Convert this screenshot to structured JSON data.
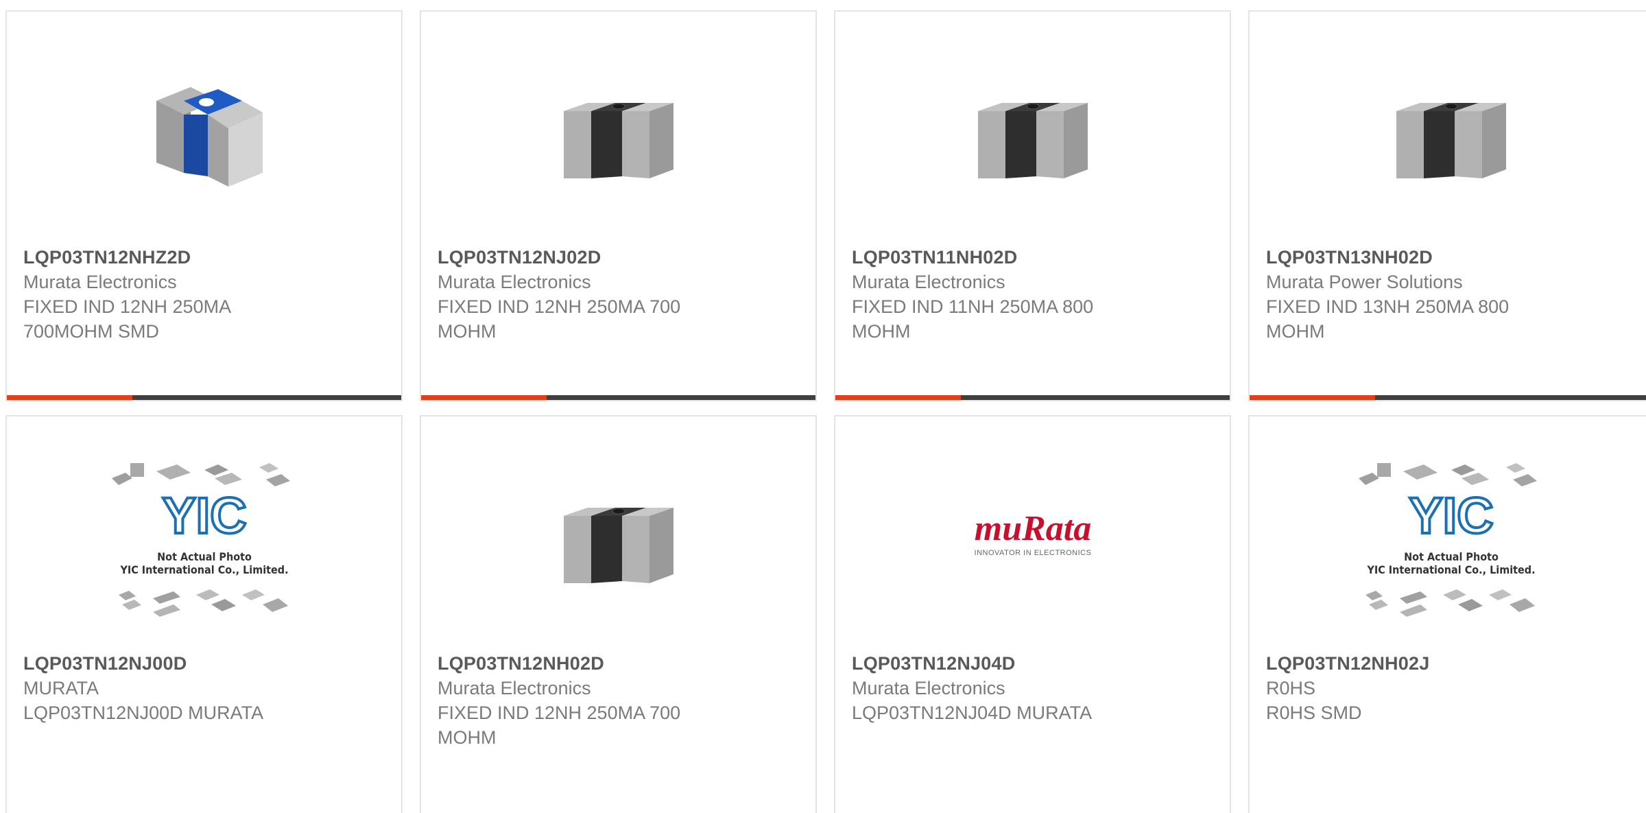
{
  "colors": {
    "accent": "#e0401c",
    "bar": "#3f3f3f",
    "border": "#e4e4e4",
    "part_text": "#595959",
    "sub_text": "#7a7a7a",
    "murata_red": "#c8102e",
    "yic_blue": "#1a6fb5"
  },
  "products": [
    {
      "part": "LQP03TN12NHZ2D",
      "maker": "Murata Electronics",
      "desc": "FIXED IND 12NH 250MA 700MOHM SMD",
      "image": "blue-chip-inductor"
    },
    {
      "part": "LQP03TN12NJ02D",
      "maker": "Murata Electronics",
      "desc": "FIXED IND 12NH 250MA 700 MOHM",
      "image": "black-chip-inductor"
    },
    {
      "part": "LQP03TN11NH02D",
      "maker": "Murata Electronics",
      "desc": "FIXED IND 11NH 250MA 800 MOHM",
      "image": "black-chip-inductor"
    },
    {
      "part": "LQP03TN13NH02D",
      "maker": "Murata Power Solutions",
      "desc": "FIXED IND 13NH 250MA 800 MOHM",
      "image": "black-chip-inductor"
    },
    {
      "part": "LQP03TN12NJ00D",
      "maker": "MURATA",
      "desc": "LQP03TN12NJ00D MURATA",
      "image": "not-actual-photo",
      "image_text": {
        "logo": "YIC",
        "line1": "Not Actual Photo",
        "line2": "YIC International Co., Limited."
      }
    },
    {
      "part": "LQP03TN12NH02D",
      "maker": "Murata Electronics",
      "desc": "FIXED IND 12NH 250MA 700 MOHM",
      "image": "black-chip-inductor"
    },
    {
      "part": "LQP03TN12NJ04D",
      "maker": "Murata Electronics",
      "desc": "LQP03TN12NJ04D MURATA",
      "image": "murata-logo",
      "image_text": {
        "logo": "muRata",
        "tagline": "INNOVATOR IN ELECTRONICS"
      }
    },
    {
      "part": "LQP03TN12NH02J",
      "maker": "R0HS",
      "desc": "R0HS SMD",
      "image": "not-actual-photo",
      "image_text": {
        "logo": "YIC",
        "line1": "Not Actual Photo",
        "line2": "YIC International Co., Limited."
      }
    }
  ]
}
